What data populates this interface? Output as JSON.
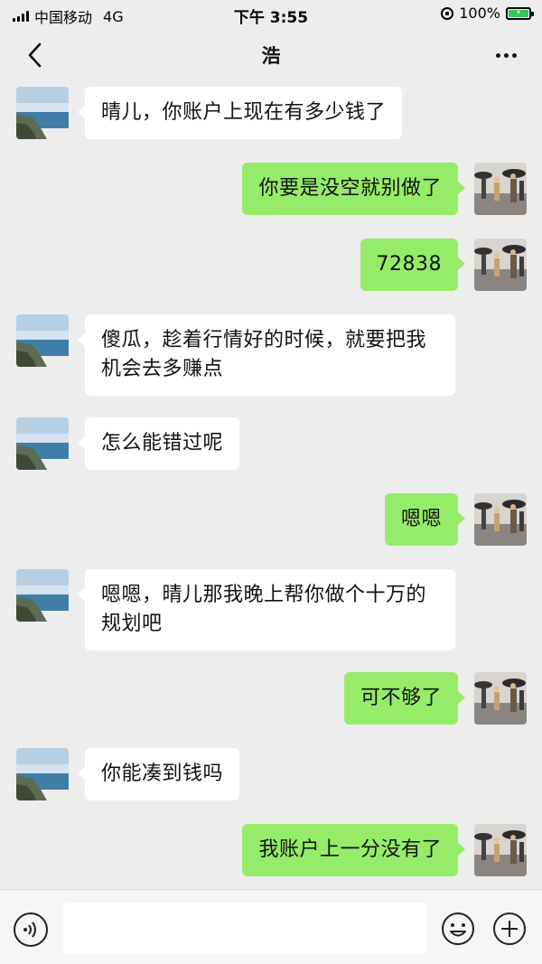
{
  "status_bar": {
    "carrier": "中国移动",
    "network": "4G",
    "time": "下午 3:55",
    "battery": "100%"
  },
  "header": {
    "title": "浩",
    "back_icon": "chevron-left-icon",
    "more_icon": "more-dots-icon"
  },
  "messages": [
    {
      "side": "left",
      "text": "晴儿，你账户上现在有多少钱了"
    },
    {
      "side": "right",
      "text": "你要是没空就别做了"
    },
    {
      "side": "right",
      "text": "72838"
    },
    {
      "side": "left",
      "text": "傻瓜，趁着行情好的时候，就要把我机会去多赚点"
    },
    {
      "side": "left",
      "text": "怎么能错过呢"
    },
    {
      "side": "right",
      "text": "嗯嗯"
    },
    {
      "side": "left",
      "text": "嗯嗯，晴儿那我晚上帮你做个十万的规划吧"
    },
    {
      "side": "right",
      "text": "可不够了"
    },
    {
      "side": "left",
      "text": "你能凑到钱吗"
    },
    {
      "side": "right",
      "text": "我账户上一分没有了"
    }
  ],
  "input_bar": {
    "input_value": "",
    "voice_icon": "voice-icon",
    "emoji_icon": "emoji-icon",
    "plus_icon": "plus-icon"
  },
  "colors": {
    "background": "#ededed",
    "bubble_sent": "#95ec69",
    "bubble_received": "#ffffff"
  }
}
